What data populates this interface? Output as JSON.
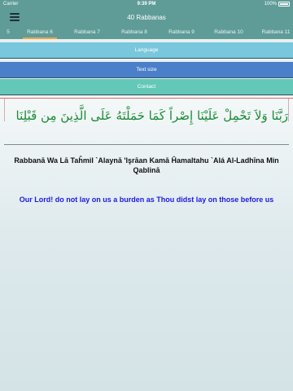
{
  "status_bar": {
    "carrier": "Carrier",
    "time": "9:39 PM",
    "battery": "100%"
  },
  "nav": {
    "title": "40 Rabbanas",
    "menu_icon": "hamburger-menu-icon"
  },
  "tabs": [
    {
      "label": "5"
    },
    {
      "label": "Rabbana 6",
      "active": true
    },
    {
      "label": "Rabbana 7"
    },
    {
      "label": "Rabbana 8"
    },
    {
      "label": "Rabbana 9"
    },
    {
      "label": "Rabbana 10"
    },
    {
      "label": "Rabbana 11"
    }
  ],
  "menu": {
    "language": "Language",
    "text_size": "Text size",
    "contact": "Contact"
  },
  "content": {
    "arabic": "رَبَّنَا وَلاَ تَحْمِلْ عَلَيْنَا إِصْراً كَمَا حَمَلْتَهُ عَلَى الَّذِينَ مِن قَبْلِنَا",
    "transliteration": "Rabbanā Wa Lā Taĥmil `Alaynā 'Işrāan Kamā Ĥamaltahu `Alá Al-Ladhīna Min Qablinā",
    "translation": "Our Lord! do not lay on us a burden as Thou didst lay on those before us"
  },
  "colors": {
    "header": "#5f9c98",
    "active_tab_indicator": "#f2a34a",
    "language_button": "#78c7dc",
    "textsize_button": "#4c7fc9",
    "contact_button": "#63c8b8",
    "arabic_text": "#1a8a37",
    "translation_text": "#1a1ae0"
  }
}
